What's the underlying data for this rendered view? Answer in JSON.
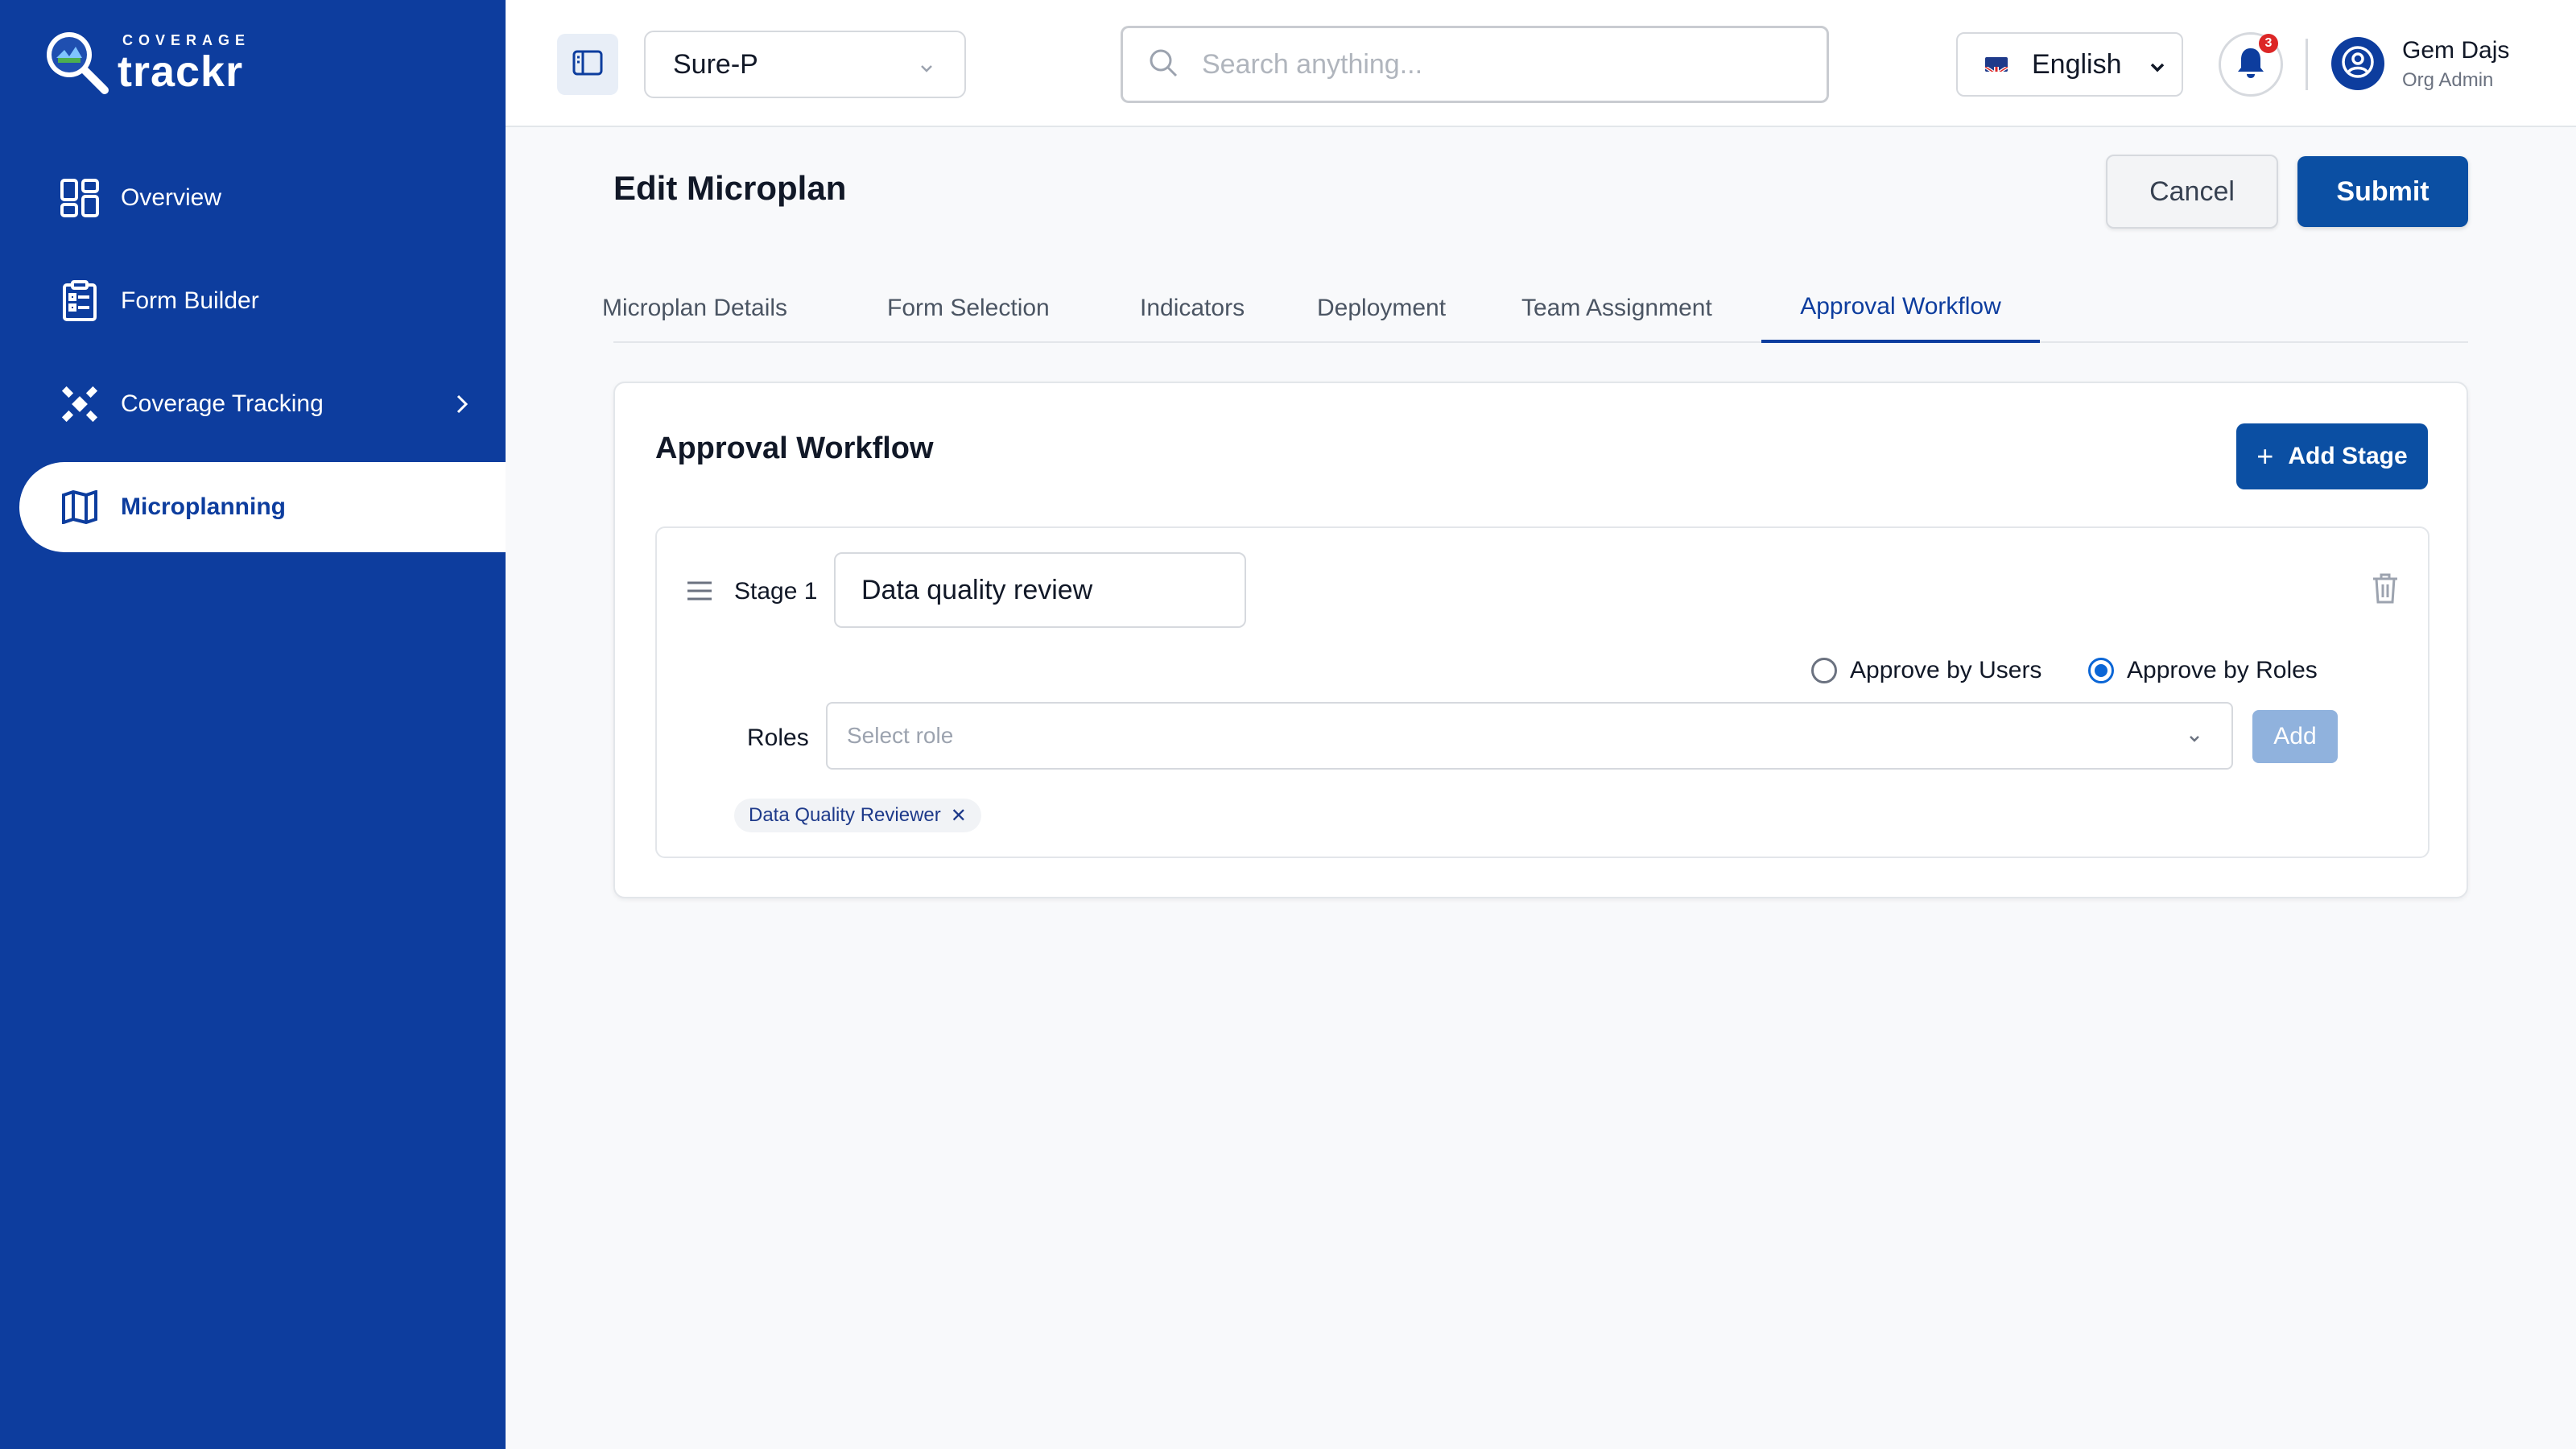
{
  "brand": {
    "tagline": "COVERAGE",
    "name": "trackr"
  },
  "sidebar": {
    "items": [
      {
        "label": "Overview",
        "icon": "grid-icon"
      },
      {
        "label": "Form Builder",
        "icon": "clipboard-icon"
      },
      {
        "label": "Coverage Tracking",
        "icon": "satellite-icon",
        "chevron": "chevron-right-icon"
      },
      {
        "label": "Microplanning",
        "icon": "map-icon",
        "active": true
      }
    ]
  },
  "topbar": {
    "project": "Sure-P",
    "search_placeholder": "Search anything...",
    "language": "English",
    "notifications_count": "3",
    "user_name": "Gem Dajs",
    "user_role": "Org Admin"
  },
  "page": {
    "title": "Edit Microplan",
    "cancel_label": "Cancel",
    "submit_label": "Submit",
    "tabs": [
      {
        "label": "Microplan Details"
      },
      {
        "label": "Form Selection"
      },
      {
        "label": "Indicators"
      },
      {
        "label": "Deployment"
      },
      {
        "label": "Team Assignment"
      },
      {
        "label": "Approval Workflow",
        "active": true
      }
    ]
  },
  "workflow": {
    "title": "Approval Workflow",
    "add_stage_label": "Add Stage",
    "stage": {
      "label": "Stage 1",
      "name_value": "Data quality review",
      "option_users": "Approve by Users",
      "option_roles": "Approve by Roles",
      "selected_option": "roles",
      "roles_label": "Roles",
      "roles_placeholder": "Select role",
      "add_label": "Add",
      "chips": [
        "Data Quality Reviewer"
      ]
    }
  },
  "colors": {
    "primary": "#0d3d9e",
    "button": "#0b4fa3",
    "badge": "#dc2626"
  }
}
